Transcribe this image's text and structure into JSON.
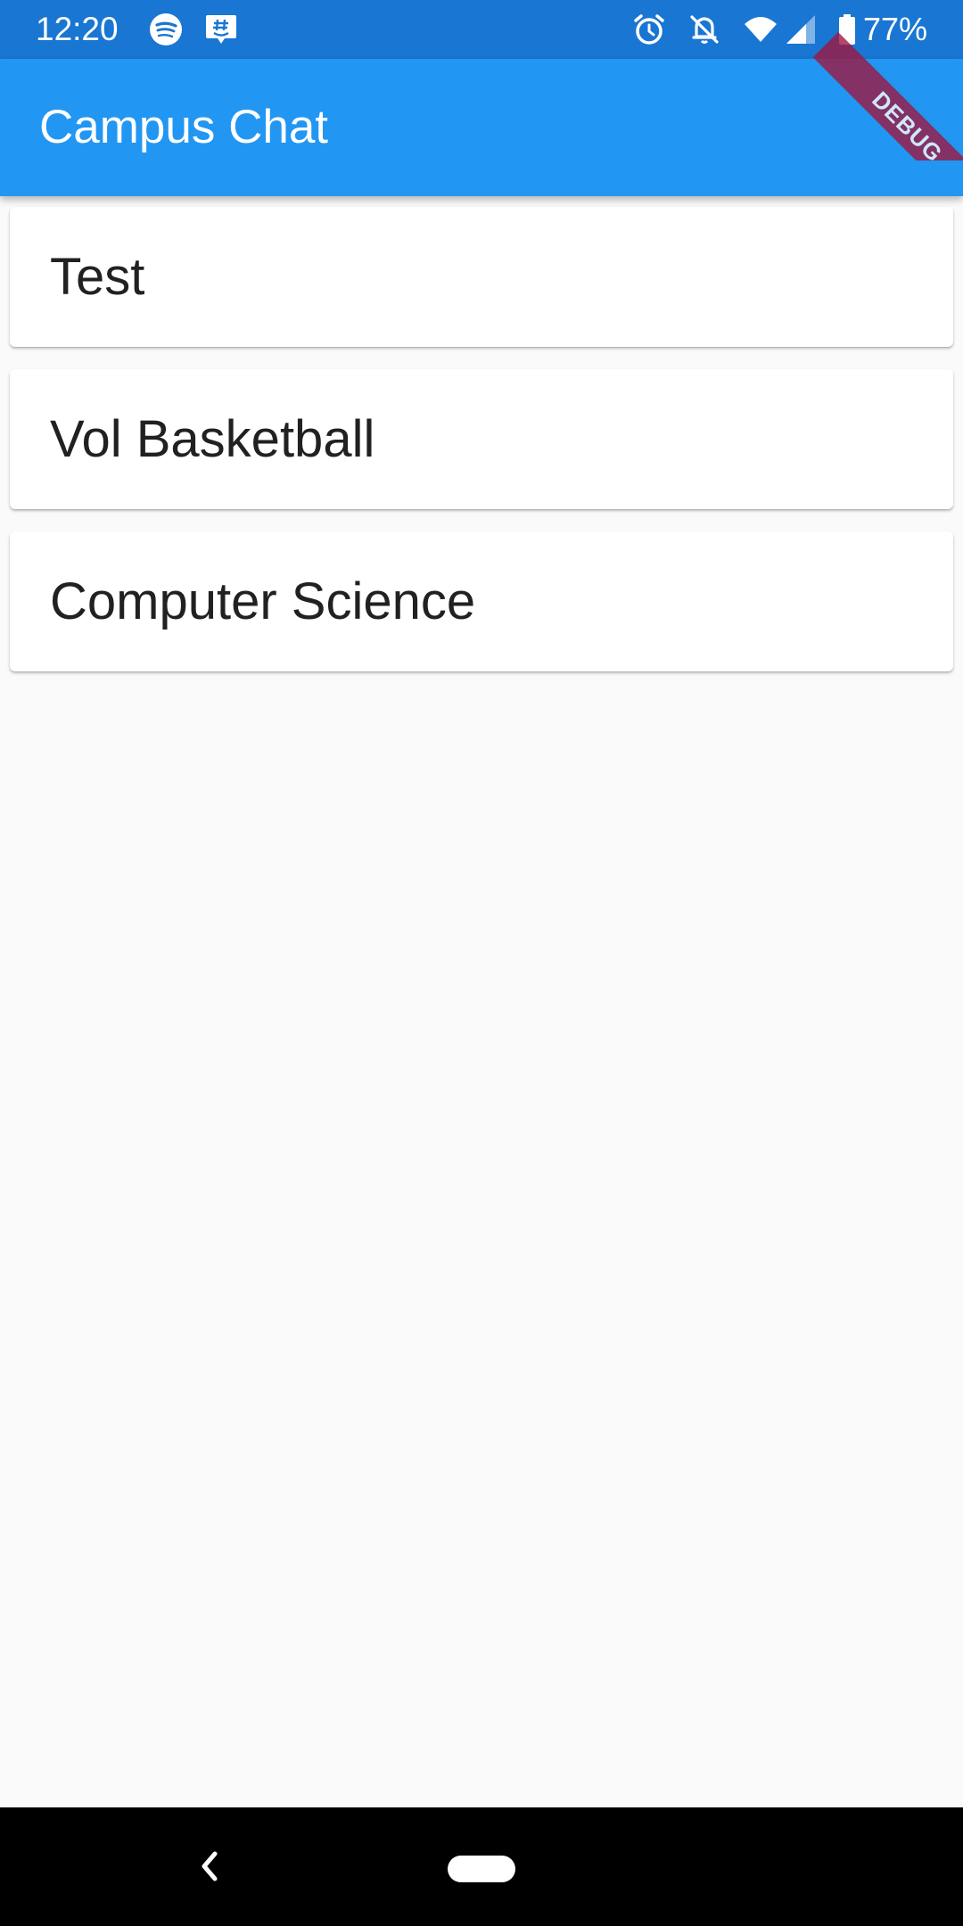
{
  "status_bar": {
    "time": "12:20",
    "battery": "77%",
    "icons": [
      "spotify-icon",
      "groupme-icon",
      "alarm-icon",
      "notifications-off-icon",
      "wifi-icon",
      "cell-signal-icon",
      "battery-icon"
    ]
  },
  "app_bar": {
    "title": "Campus Chat"
  },
  "debug_banner": {
    "label": "DEBUG"
  },
  "chats": [
    {
      "name": "Test"
    },
    {
      "name": "Vol Basketball"
    },
    {
      "name": "Computer Science"
    }
  ],
  "colors": {
    "status_bar": "#1976d2",
    "app_bar": "#2196f3",
    "background": "#fafafa",
    "debug_ribbon": "#a0153e"
  }
}
